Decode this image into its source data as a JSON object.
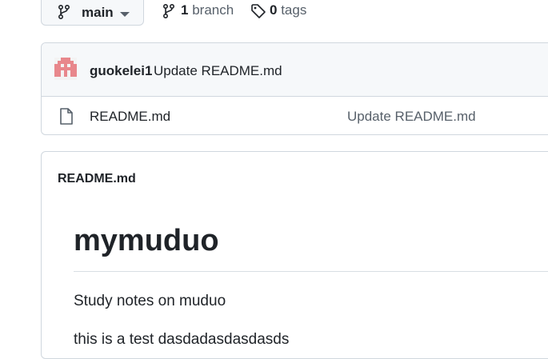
{
  "branch": {
    "name": "main"
  },
  "repo_meta": {
    "branch_count": "1",
    "branch_label": "branch",
    "tag_count": "0",
    "tag_label": "tags"
  },
  "latest_commit": {
    "author": "guokelei1",
    "message": "Update README.md"
  },
  "files": [
    {
      "name": "README.md",
      "commit_message": "Update README.md",
      "icon": "file-icon"
    }
  ],
  "readme": {
    "header_title": "README.md",
    "heading": "mymuduo",
    "paragraphs": [
      "Study notes on muduo",
      "this is a test dasdadasdasdasds"
    ]
  },
  "colors": {
    "border": "#d0d7de",
    "muted_text": "#57606a",
    "text": "#1f2328",
    "avatar": "#e8878c"
  }
}
